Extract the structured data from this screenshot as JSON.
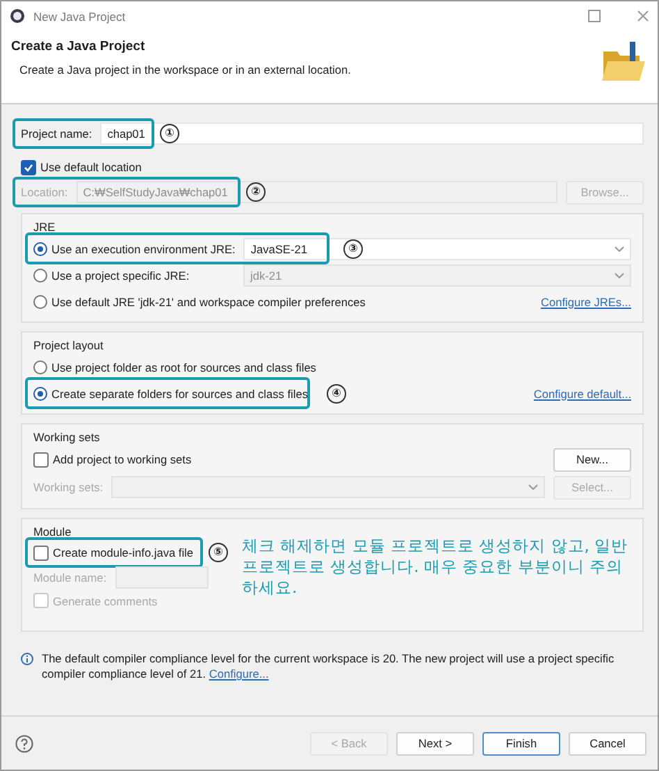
{
  "window": {
    "title": "New Java Project"
  },
  "header": {
    "title": "Create a Java Project",
    "description": "Create a Java project in the workspace or in an external location."
  },
  "project_name": {
    "label": "Project name:",
    "value": "chap01",
    "callout": "①"
  },
  "use_default_location": {
    "label": "Use default location",
    "checked": true
  },
  "location": {
    "label": "Location:",
    "value": "C:₩SelfStudyJava₩chap01",
    "disabled": true,
    "callout": "②",
    "button": "Browse..."
  },
  "jre": {
    "title": "JRE",
    "options": [
      {
        "kind": "combo",
        "label": "Use an execution environment JRE:",
        "selected": true,
        "value": "JavaSE-21",
        "disabled": false,
        "callout": "③"
      },
      {
        "kind": "combo",
        "label": "Use a project specific JRE:",
        "selected": false,
        "value": "jdk-21",
        "disabled": true
      },
      {
        "kind": "link",
        "label": "Use default JRE 'jdk-21' and workspace compiler preferences",
        "selected": false,
        "link": "Configure JREs..."
      }
    ]
  },
  "project_layout": {
    "title": "Project layout",
    "options": [
      {
        "kind": "plain",
        "label": "Use project folder as root for sources and class files",
        "selected": false
      },
      {
        "kind": "link",
        "label": "Create separate folders for sources and class files",
        "selected": true,
        "callout": "④",
        "link": "Configure default..."
      }
    ]
  },
  "working_sets": {
    "title": "Working sets",
    "checkbox": {
      "label": "Add project to working sets",
      "checked": false
    },
    "new_button": "New...",
    "field_label": "Working sets:",
    "disabled": true,
    "select_button": "Select..."
  },
  "module": {
    "title": "Module",
    "checkbox": {
      "label": "Create module-info.java file",
      "checked": false,
      "callout": "⑤"
    },
    "name_label": "Module name:",
    "disabled": true,
    "comments": {
      "label": "Generate comments",
      "checked": false
    }
  },
  "note": "체크 해제하면 모듈 프로젝트로 생성하지 않고, 일반 프로젝트로 생성합니다. 매우 중요한 부분이니 주의하세요.",
  "info": {
    "text": "The default compiler compliance level for the current workspace is 20. The new project will use a project specific compiler compliance level of 21.",
    "link": "Configure..."
  },
  "buttons": [
    {
      "label": "< Back",
      "disabled": true,
      "default": false
    },
    {
      "label": "Next >",
      "disabled": false,
      "default": false
    },
    {
      "label": "Finish",
      "disabled": false,
      "default": true
    },
    {
      "label": "Cancel",
      "disabled": false,
      "default": false
    }
  ]
}
